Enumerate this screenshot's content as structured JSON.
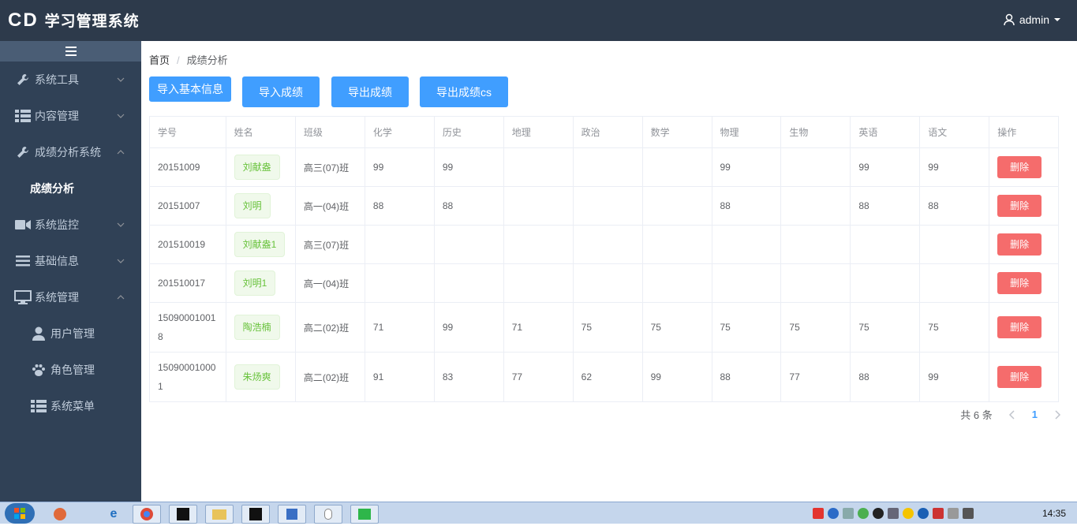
{
  "header": {
    "logo": "CD",
    "title": "学习管理系统",
    "user": "admin"
  },
  "sidebar": {
    "items": [
      {
        "label": "系统工具",
        "icon": "wrench-icon",
        "expanded": false
      },
      {
        "label": "内容管理",
        "icon": "list-icon",
        "expanded": false
      },
      {
        "label": "成绩分析系统",
        "icon": "wrench-icon",
        "expanded": true
      },
      {
        "label": "成绩分析",
        "sub": true,
        "active": true
      },
      {
        "label": "系统监控",
        "icon": "video-icon",
        "expanded": false
      },
      {
        "label": "基础信息",
        "icon": "menu-icon",
        "expanded": false
      },
      {
        "label": "系统管理",
        "icon": "monitor-icon",
        "expanded": true
      },
      {
        "label": "用户管理",
        "icon": "user-icon",
        "sub": true
      },
      {
        "label": "角色管理",
        "icon": "paw-icon",
        "sub": true
      },
      {
        "label": "系统菜单",
        "icon": "list-icon",
        "sub": true
      }
    ]
  },
  "breadcrumb": {
    "home": "首页",
    "separator": "/",
    "current": "成绩分析"
  },
  "toolbar": {
    "import_basic": "导入基本信息",
    "import_scores": "导入成绩",
    "export_scores": "导出成绩",
    "export_scores_cs": "导出成绩cs"
  },
  "table": {
    "headers": [
      "学号",
      "姓名",
      "班级",
      "化学",
      "历史",
      "地理",
      "政治",
      "数学",
      "物理",
      "生物",
      "英语",
      "语文",
      "操作"
    ],
    "delete_label": "删除",
    "rows": [
      {
        "id": "20151009",
        "name": "刘献盎",
        "class": "高三(07)班",
        "chem": "99",
        "hist": "99",
        "geo": "",
        "pol": "",
        "math": "",
        "phys": "99",
        "bio": "",
        "eng": "99",
        "chn": "99"
      },
      {
        "id": "20151007",
        "name": "刘明",
        "class": "高一(04)班",
        "chem": "88",
        "hist": "88",
        "geo": "",
        "pol": "",
        "math": "",
        "phys": "88",
        "bio": "",
        "eng": "88",
        "chn": "88"
      },
      {
        "id": "201510019",
        "name": "刘献盎1",
        "class": "高三(07)班",
        "chem": "",
        "hist": "",
        "geo": "",
        "pol": "",
        "math": "",
        "phys": "",
        "bio": "",
        "eng": "",
        "chn": ""
      },
      {
        "id": "201510017",
        "name": "刘明1",
        "class": "高一(04)班",
        "chem": "",
        "hist": "",
        "geo": "",
        "pol": "",
        "math": "",
        "phys": "",
        "bio": "",
        "eng": "",
        "chn": ""
      },
      {
        "id": "150900010018",
        "name": "陶浩楠",
        "class": "高二(02)班",
        "chem": "71",
        "hist": "99",
        "geo": "71",
        "pol": "75",
        "math": "75",
        "phys": "75",
        "bio": "75",
        "eng": "75",
        "chn": "75"
      },
      {
        "id": "150900010001",
        "name": "朱炀爽",
        "class": "高二(02)班",
        "chem": "91",
        "hist": "83",
        "geo": "77",
        "pol": "62",
        "math": "99",
        "phys": "88",
        "bio": "77",
        "eng": "88",
        "chn": "99"
      }
    ]
  },
  "pagination": {
    "total": "共 6 条",
    "current_page": "1"
  },
  "taskbar": {
    "clock": "14:35"
  },
  "colors": {
    "header": "#2d3a4b",
    "sidebar": "#304156",
    "primary": "#409eff",
    "danger": "#f56c6c",
    "success": "#67c23a"
  }
}
